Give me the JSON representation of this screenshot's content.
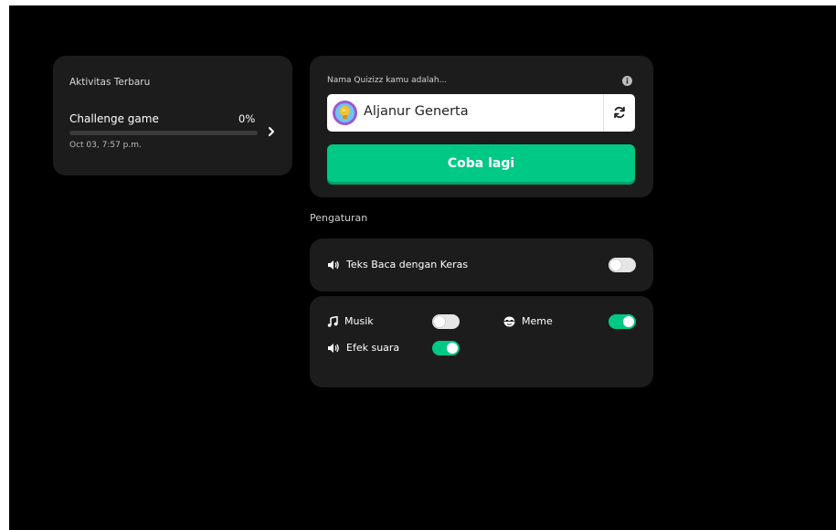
{
  "activity": {
    "title": "Aktivitas Terbaru",
    "game_name": "Challenge game",
    "percent_label": "0%",
    "progress": 0,
    "date": "Oct 03, 7:57 p.m."
  },
  "name_card": {
    "label": "Nama Quizizz kamu adalah...",
    "name_value": "Aljanur Generta",
    "retry_label": "Coba lagi"
  },
  "settings": {
    "title": "Pengaturan",
    "read_aloud": {
      "label": "Teks Baca dengan Keras",
      "enabled": false
    },
    "music": {
      "label": "Musik",
      "enabled": false
    },
    "meme": {
      "label": "Meme",
      "enabled": true
    },
    "sound_effects": {
      "label": "Efek suara",
      "enabled": true
    }
  },
  "colors": {
    "accent": "#00c985",
    "card": "#1c1c1c",
    "background": "#000000"
  },
  "icons": {
    "chevron": "chevron-right-icon",
    "info": "info-icon",
    "refresh": "refresh-icon",
    "avatar": "lightbulb-avatar-icon",
    "speaker": "speaker-icon",
    "music": "music-note-icon",
    "meme": "meme-face-icon"
  }
}
